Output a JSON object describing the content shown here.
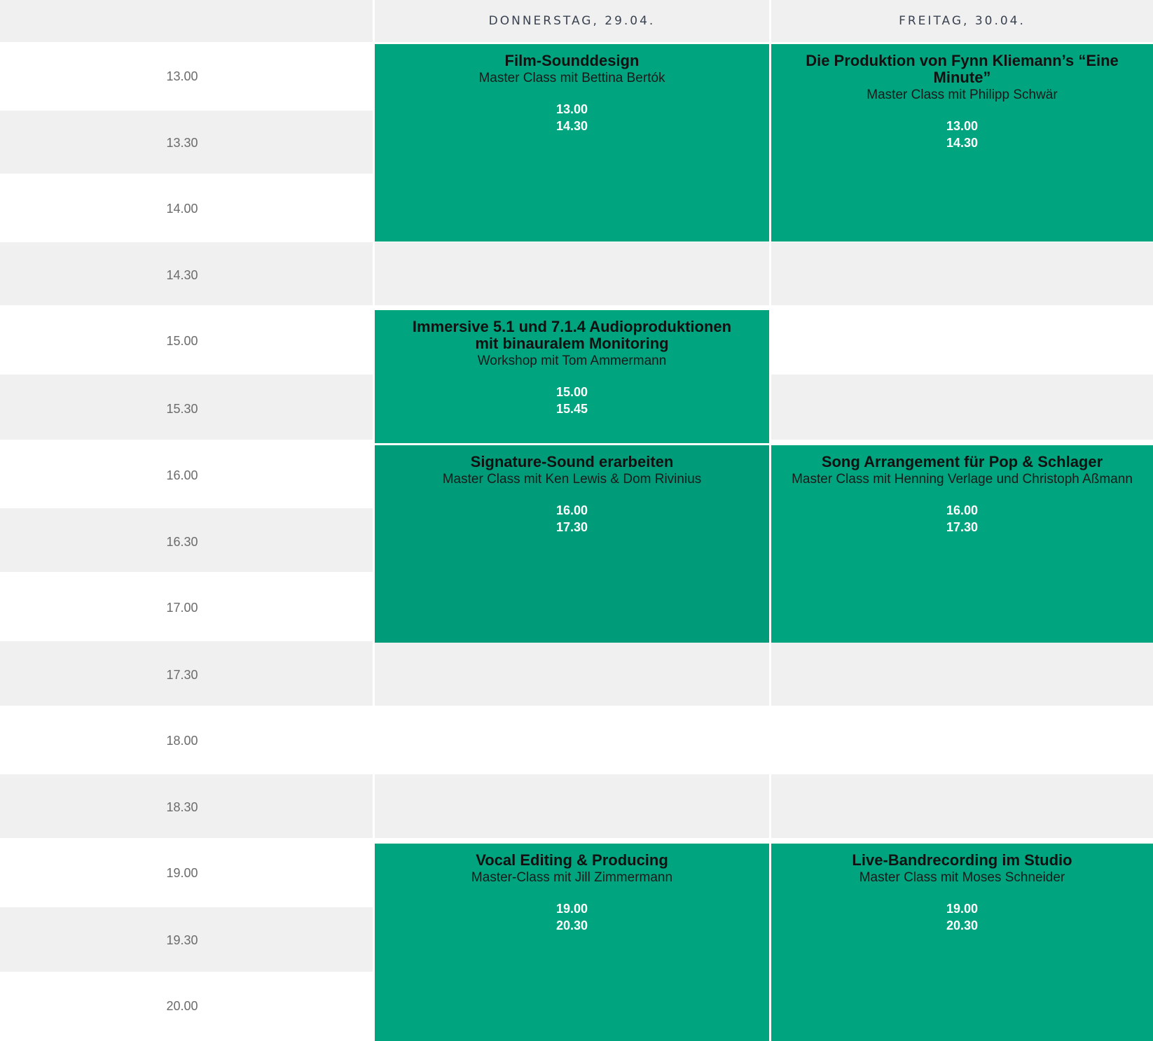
{
  "days": [
    "DONNERSTAG, 29.04.",
    "FREITAG, 30.04."
  ],
  "time_slots": [
    "13.00",
    "13.30",
    "14.00",
    "14.30",
    "15.00",
    "15.30",
    "16.00",
    "16.30",
    "17.00",
    "17.30",
    "18.00",
    "18.30",
    "19.00",
    "19.30",
    "20.00"
  ],
  "colors": {
    "event": "#00a57f",
    "event_hover": "#009c79",
    "shade": "#f0f0f0"
  },
  "events": [
    {
      "title": "Film-Sounddesign",
      "subtitle": "Master Class mit Bettina Bertók",
      "start": "13.00",
      "end": "14.30"
    },
    {
      "title": "Die Produktion von Fynn Kliemann’s “Eine Minute”",
      "subtitle": "Master Class mit Philipp Schwär",
      "start": "13.00",
      "end": "14.30"
    },
    {
      "title": "Immersive 5.1 und 7.1.4 Audioproduktionen mit binauralem Monitoring",
      "subtitle": "Workshop mit Tom Ammermann",
      "start": "15.00",
      "end": "15.45"
    },
    {
      "title": "Signature-Sound erarbeiten",
      "subtitle": "Master Class mit Ken Lewis & Dom Rivinius",
      "start": "16.00",
      "end": "17.30"
    },
    {
      "title": "Song Arrangement für Pop & Schlager",
      "subtitle": "Master Class mit Henning Verlage und Christoph Aßmann",
      "start": "16.00",
      "end": "17.30"
    },
    {
      "title": "Vocal Editing & Producing",
      "subtitle": "Master-Class mit Jill Zimmermann",
      "start": "19.00",
      "end": "20.30"
    },
    {
      "title": "Live-Bandrecording im Studio",
      "subtitle": "Master Class mit Moses Schneider",
      "start": "19.00",
      "end": "20.30"
    }
  ]
}
